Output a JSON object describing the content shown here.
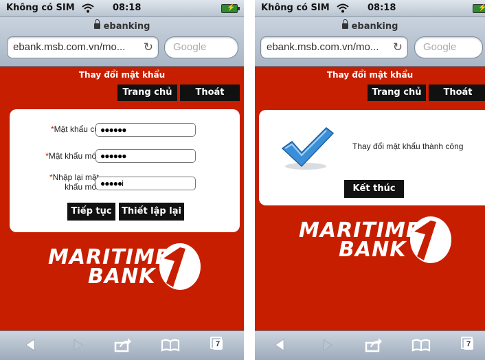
{
  "screens": [
    {
      "status": {
        "carrier": "Không có SIM",
        "time": "08:18"
      },
      "browser": {
        "page_title": "ebanking",
        "url": "ebank.msb.com.vn/mo...",
        "search_placeholder": "Google"
      },
      "page": {
        "section_title": "Thay đổi mật khẩu",
        "nav": {
          "home": "Trang chủ",
          "logout": "Thoát"
        },
        "form": {
          "old_password_label": "Mật khẩu cũ",
          "old_password_value": "●●●●●●",
          "new_password_label": "Mật khẩu mới",
          "new_password_value": "●●●●●●",
          "confirm_label_line1": "Nhập lại mật",
          "confirm_label_line2": "khẩu mới",
          "confirm_value": "●●●●●i",
          "required_mark": "*",
          "continue_button": "Tiếp tục",
          "reset_button": "Thiết lập lại"
        },
        "logo": {
          "line1": "MARITIME",
          "line2": "BANK"
        }
      },
      "toolbar": {
        "tabs_count": "7"
      }
    },
    {
      "status": {
        "carrier": "Không có SIM",
        "time": "08:18"
      },
      "browser": {
        "page_title": "ebanking",
        "url": "ebank.msb.com.vn/mo...",
        "search_placeholder": "Google"
      },
      "page": {
        "section_title": "Thay đổi mật khẩu",
        "nav": {
          "home": "Trang chủ",
          "logout": "Thoát"
        },
        "message": "Thay đổi mật khẩu thành công",
        "finish_button": "Kết thúc",
        "logo": {
          "line1": "MARITIME",
          "line2": "BANK"
        }
      },
      "toolbar": {
        "tabs_count": "7"
      }
    }
  ],
  "colors": {
    "brand_red": "#c81e00",
    "button_black": "#111111",
    "check_blue": "#3b8fd8"
  }
}
